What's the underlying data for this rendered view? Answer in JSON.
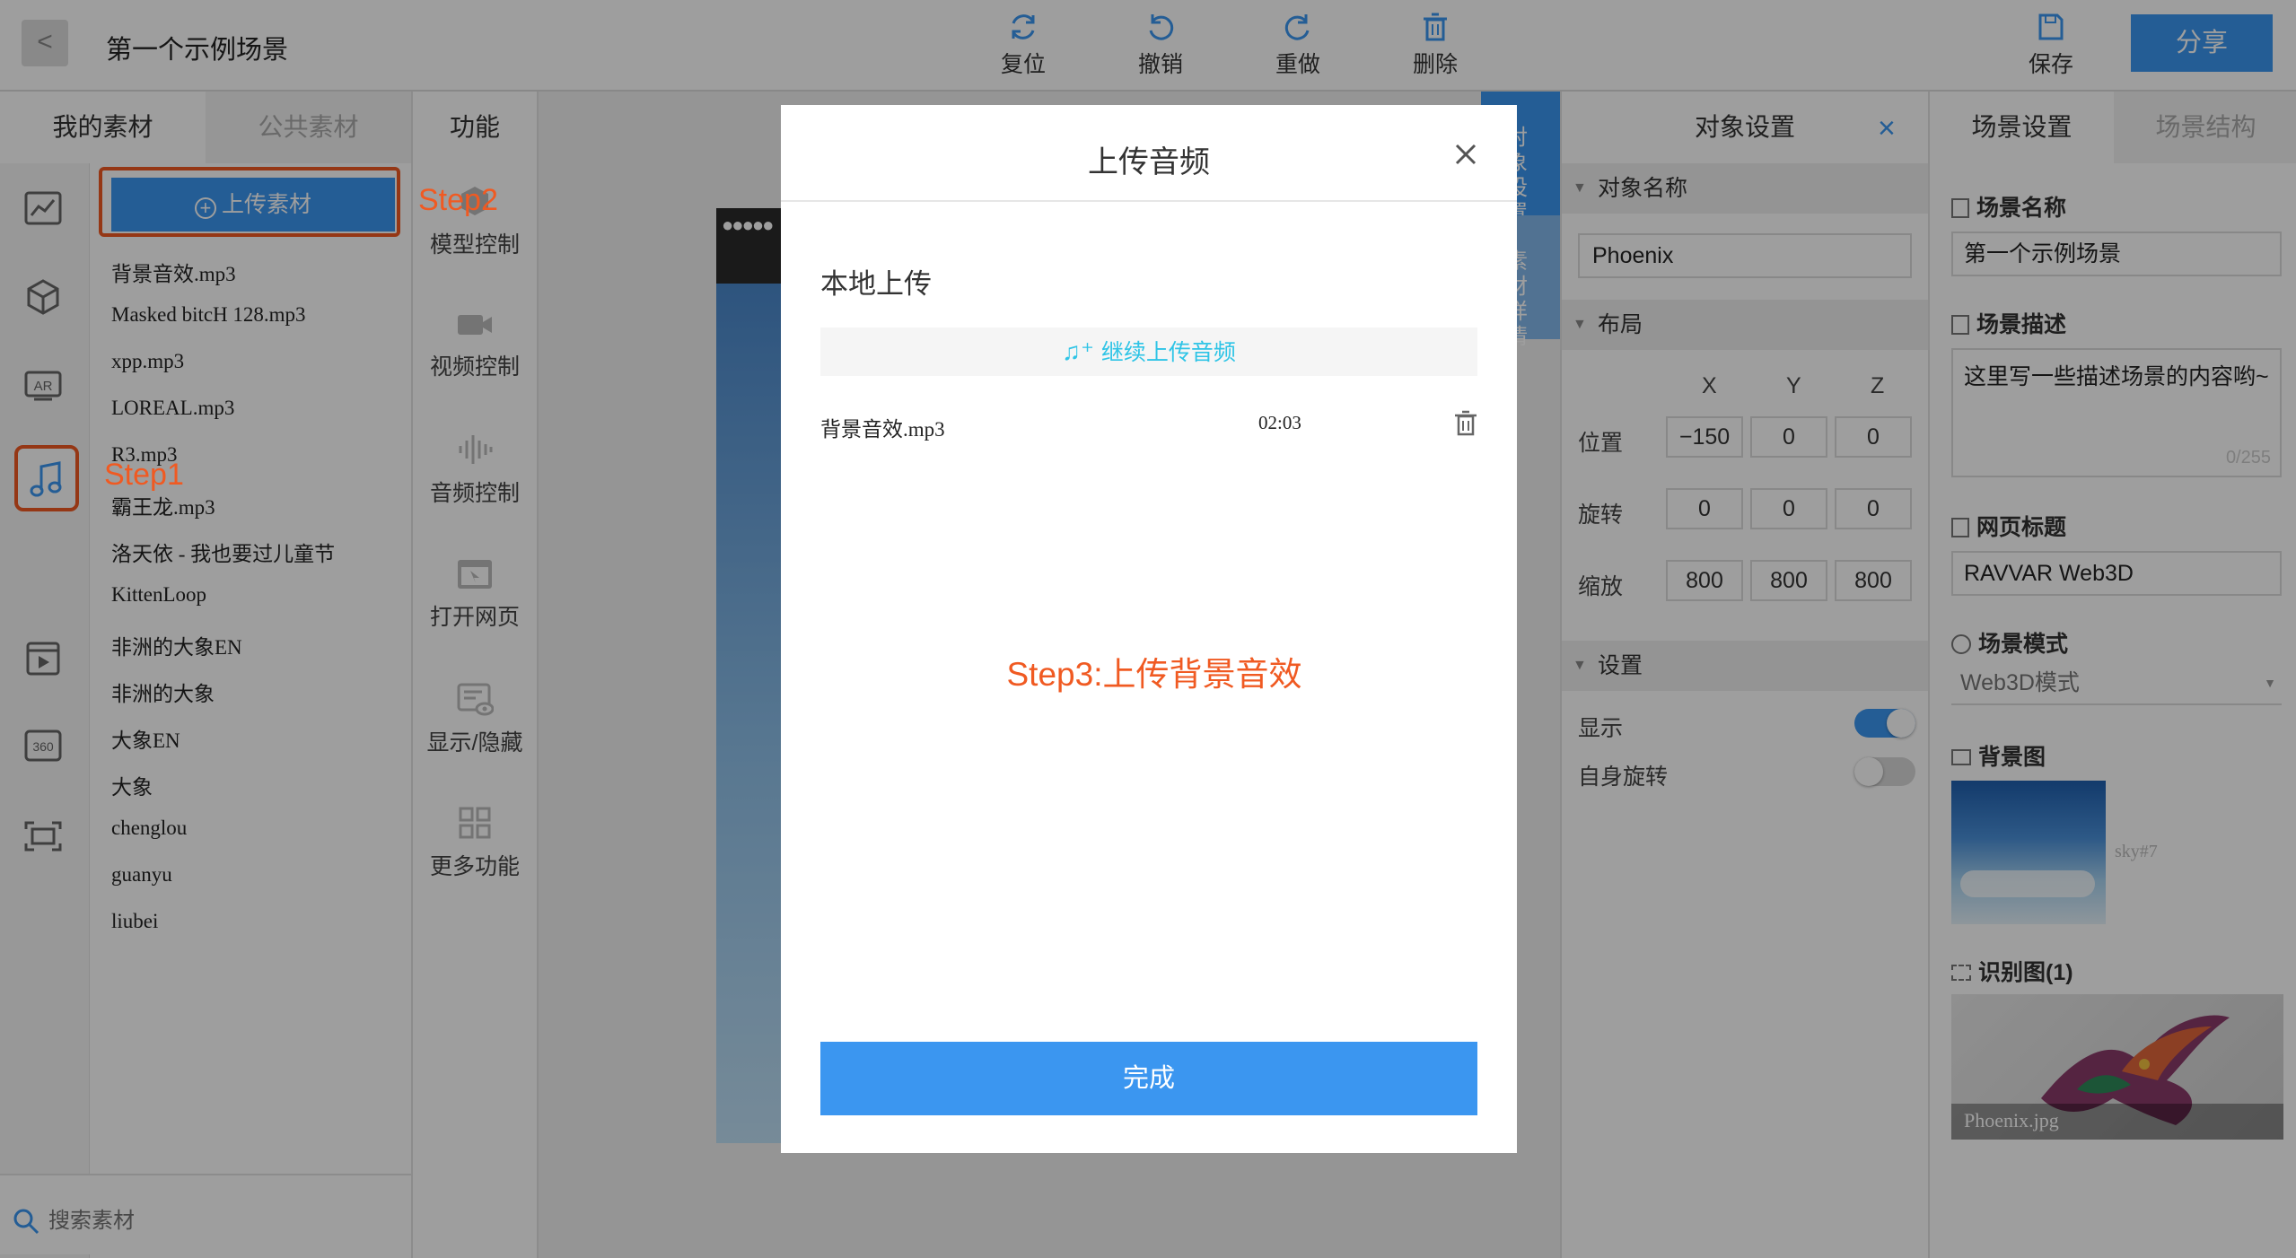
{
  "header": {
    "back_label": "<",
    "scene_title": "第一个示例场景",
    "tools": [
      {
        "label": "复位",
        "icon": "reset-icon"
      },
      {
        "label": "撤销",
        "icon": "undo-icon"
      },
      {
        "label": "重做",
        "icon": "redo-icon"
      },
      {
        "label": "删除",
        "icon": "trash-icon"
      }
    ],
    "save_label": "保存",
    "share_label": "分享"
  },
  "materials": {
    "tab_mine": "我的素材",
    "tab_public": "公共素材",
    "upload_label": "上传素材",
    "items": [
      "背景音效.mp3",
      "Masked bitcH 128.mp3",
      "xpp.mp3",
      "LOREAL.mp3",
      "R3.mp3",
      "霸王龙.mp3",
      "洛天依 - 我也要过儿童节",
      "KittenLoop",
      "非洲的大象EN",
      "非洲的大象",
      "大象EN",
      "大象",
      "chenglou",
      "guanyu",
      "liubei"
    ],
    "search_placeholder": "搜索素材",
    "side_icons": [
      "chart-icon",
      "cube-icon",
      "ar-icon",
      "music-icon",
      "video-icon",
      "360-icon",
      "scan-icon"
    ]
  },
  "functions": {
    "tab_label": "功能",
    "items": [
      "模型控制",
      "视频控制",
      "音频控制",
      "打开网页",
      "显示/隐藏",
      "更多功能"
    ]
  },
  "annotations": {
    "step1": "Step1",
    "step2": "Step2",
    "step3": "Step3:上传背景音效"
  },
  "canvas": {
    "side_tab_object": "对象设置",
    "side_tab_material": "素材详情"
  },
  "object_settings": {
    "title": "对象设置",
    "name_section": "对象名称",
    "name_value": "Phoenix",
    "layout_section": "布局",
    "axes": [
      "X",
      "Y",
      "Z"
    ],
    "position_label": "位置",
    "position": [
      "−150",
      "0",
      "0"
    ],
    "rotation_label": "旋转",
    "rotation": [
      "0",
      "0",
      "0"
    ],
    "scale_label": "缩放",
    "scale": [
      "800",
      "800",
      "800"
    ],
    "settings_section": "设置",
    "show_label": "显示",
    "show_on": true,
    "self_rotate_label": "自身旋转",
    "self_rotate_on": false
  },
  "scene_settings": {
    "tab_settings": "场景设置",
    "tab_structure": "场景结构",
    "name_label": "场景名称",
    "name_value": "第一个示例场景",
    "desc_label": "场景描述",
    "desc_value": "这里写一些描述场景的内容哟~",
    "desc_counter": "0/255",
    "webtitle_label": "网页标题",
    "webtitle_value": "RAVVAR Web3D",
    "mode_label": "场景模式",
    "mode_value": "Web3D模式",
    "bg_label": "背景图",
    "bg_name": "sky#7",
    "recog_label": "识别图(1)",
    "recog_name": "Phoenix.jpg"
  },
  "modal": {
    "title": "上传音频",
    "local_upload": "本地上传",
    "continue_upload": "继续上传音频",
    "file_name": "背景音效.mp3",
    "file_duration": "02:03",
    "done_label": "完成"
  },
  "colors": {
    "accent": "#3b96f0",
    "annotation_red": "#f05a22",
    "upload_teal": "#2ec4e6"
  }
}
